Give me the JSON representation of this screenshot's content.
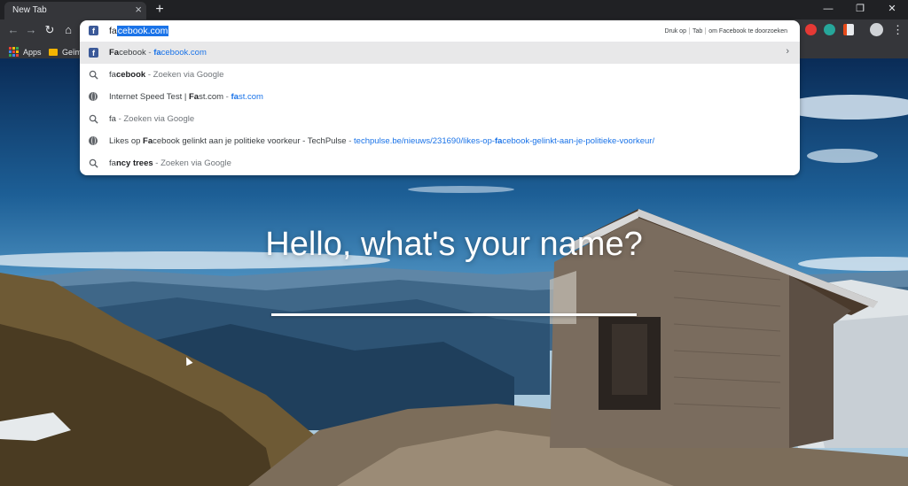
{
  "tab": {
    "title": "New Tab"
  },
  "bookmarks": {
    "apps_label": "Apps",
    "folder_label": "Geïm"
  },
  "omnibox": {
    "typed": "fa",
    "completion": "cebook.com",
    "hint_prefix": "Druk op",
    "hint_key": "Tab",
    "hint_suffix": "om Facebook te doorzoeken"
  },
  "suggestions": [
    {
      "icon": "facebook-favicon",
      "match": "Fa",
      "rest": "cebook",
      "dash": " - ",
      "url_match": "fa",
      "url_rest": "cebook.com"
    },
    {
      "icon": "search-icon",
      "prefix": "fa",
      "bold": "cebook",
      "suffix": " - Zoeken via Google"
    },
    {
      "icon": "globe-icon",
      "text_a": "Internet Speed Test | ",
      "match": "Fa",
      "text_b": "st.com",
      "dash": " - ",
      "url_match": "fa",
      "url_rest": "st.com"
    },
    {
      "icon": "search-icon",
      "prefix": "fa",
      "suffix": " - Zoeken via Google"
    },
    {
      "icon": "globe-icon",
      "text_a": "Likes op ",
      "match": "Fa",
      "text_b": "cebook gelinkt aan je politieke voorkeur - TechPulse",
      "dash": " - ",
      "url_a": "techpulse.be/nieuws/231690/likes-op-",
      "url_match": "fa",
      "url_b": "cebook-gelinkt-aan-je-politieke-voorkeur/"
    },
    {
      "icon": "search-icon",
      "prefix": "fa",
      "bold": "ncy trees",
      "suffix": " - Zoeken via Google"
    }
  ],
  "greeting": "Hello, what's your name?",
  "colors": {
    "chrome_dark": "#202124",
    "toolbar": "#35363a",
    "accent": "#1a73e8",
    "facebook": "#3b5998"
  }
}
